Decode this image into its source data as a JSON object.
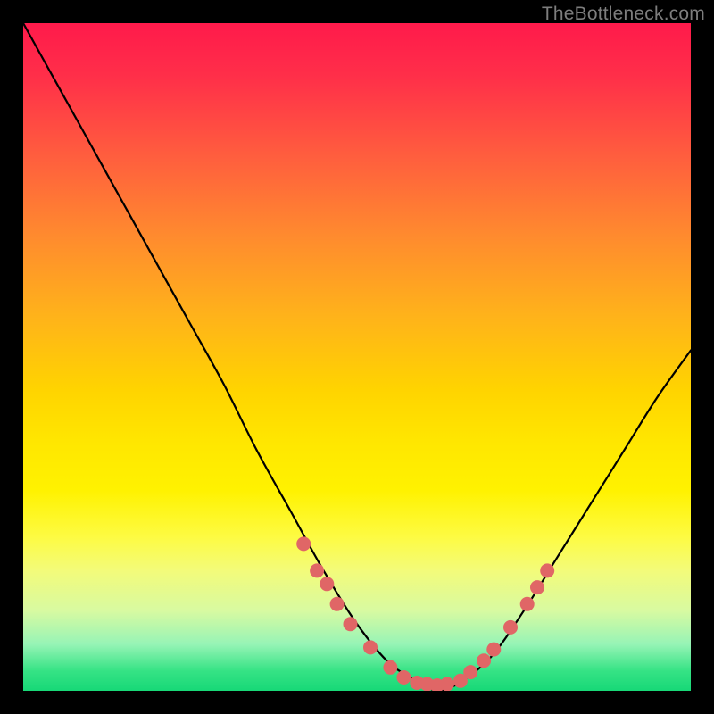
{
  "watermark_text": "TheBottleneck.com",
  "chart_data": {
    "type": "line",
    "title": "",
    "xlabel": "",
    "ylabel": "",
    "ylim": [
      0,
      100
    ],
    "x": [
      0,
      5,
      10,
      15,
      20,
      25,
      30,
      35,
      40,
      45,
      50,
      55,
      60,
      62,
      65,
      70,
      75,
      80,
      85,
      90,
      95,
      100
    ],
    "series": [
      {
        "name": "bottleneck-curve",
        "values": [
          100,
          91,
          82,
          73,
          64,
          55,
          46,
          36,
          27,
          18,
          10,
          4,
          1,
          0,
          1,
          5,
          12,
          20,
          28,
          36,
          44,
          51
        ]
      }
    ],
    "markers": {
      "name": "highlight-points",
      "color": "#e06666",
      "points": [
        {
          "x": 42,
          "y": 22
        },
        {
          "x": 44,
          "y": 18
        },
        {
          "x": 45.5,
          "y": 16
        },
        {
          "x": 47,
          "y": 13
        },
        {
          "x": 49,
          "y": 10
        },
        {
          "x": 52,
          "y": 6.5
        },
        {
          "x": 55,
          "y": 3.5
        },
        {
          "x": 57,
          "y": 2
        },
        {
          "x": 59,
          "y": 1.2
        },
        {
          "x": 60.5,
          "y": 1
        },
        {
          "x": 62,
          "y": 0.8
        },
        {
          "x": 63.5,
          "y": 1
        },
        {
          "x": 65.5,
          "y": 1.5
        },
        {
          "x": 67,
          "y": 2.8
        },
        {
          "x": 69,
          "y": 4.5
        },
        {
          "x": 70.5,
          "y": 6.2
        },
        {
          "x": 73,
          "y": 9.5
        },
        {
          "x": 75.5,
          "y": 13
        },
        {
          "x": 77,
          "y": 15.5
        },
        {
          "x": 78.5,
          "y": 18
        }
      ]
    },
    "background_gradient": {
      "top": "#ff1a4b",
      "mid": "#ffe700",
      "bottom": "#17d877"
    }
  }
}
